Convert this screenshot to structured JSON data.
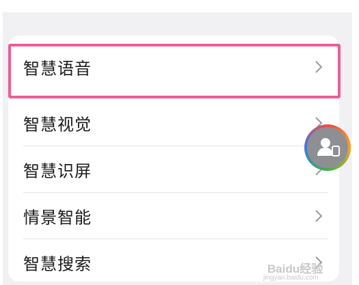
{
  "settings_list": {
    "items": [
      {
        "label": "智慧语音",
        "highlighted": true
      },
      {
        "label": "智慧视觉",
        "highlighted": false
      },
      {
        "label": "智慧识屏",
        "highlighted": false
      },
      {
        "label": "情景智能",
        "highlighted": false
      },
      {
        "label": "智慧搜索",
        "highlighted": false
      }
    ]
  },
  "overlay": {
    "highlight_color": "#ee5c96",
    "floating_button_icon": "person-card-icon"
  },
  "watermark": {
    "logo": "Baidu经验",
    "url": "jingyan.baidu.com"
  },
  "colors": {
    "background": "#f1f1f3",
    "card": "#ffffff",
    "text": "#1a1a1a",
    "chevron": "#9a9a9a"
  }
}
